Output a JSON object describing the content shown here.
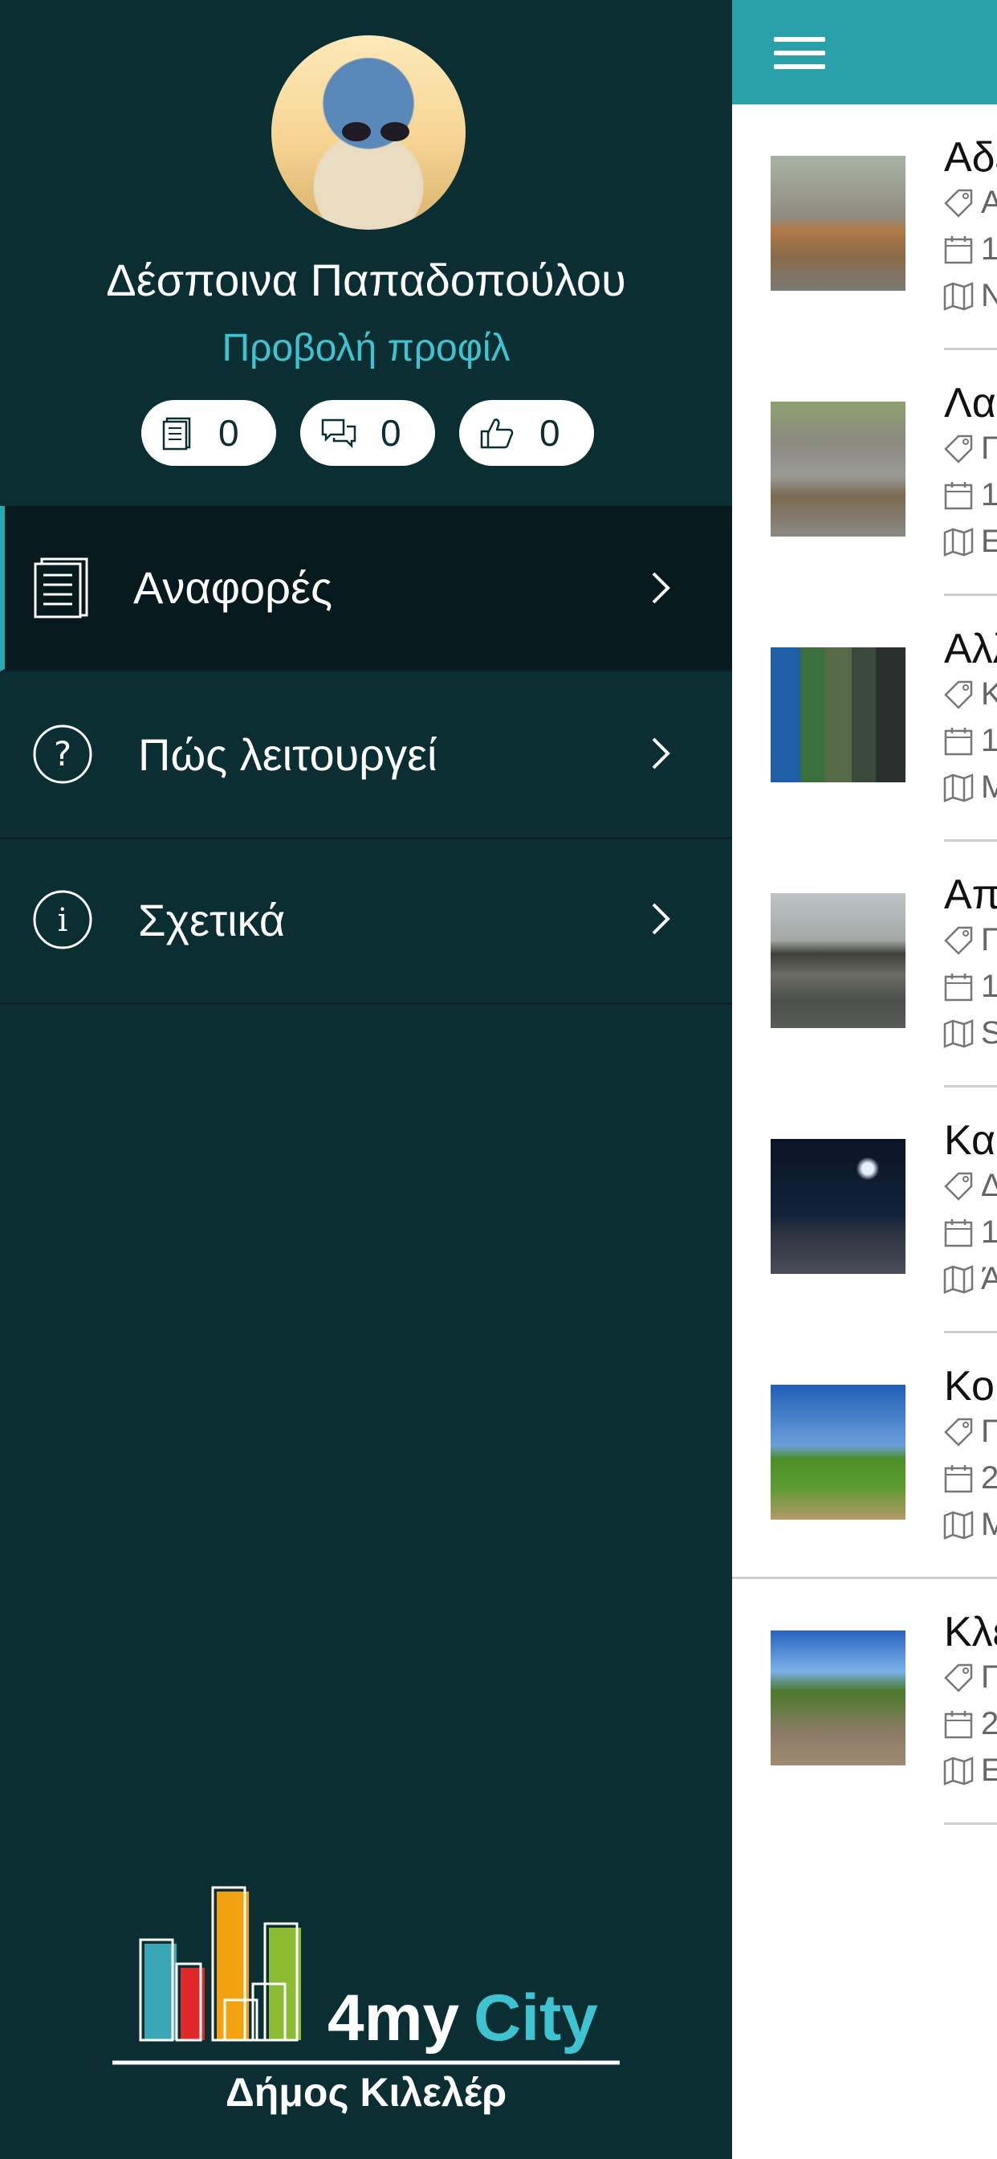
{
  "drawer": {
    "user_name": "Δέσποινα Παπαδοπούλου",
    "profile_link": "Προβολή προφίλ",
    "stats": [
      {
        "icon": "reports-icon",
        "count": "0"
      },
      {
        "icon": "comments-icon",
        "count": "0"
      },
      {
        "icon": "thumbs-up-icon",
        "count": "0"
      }
    ],
    "menu": [
      {
        "label": "Αναφορές",
        "icon": "reports-icon",
        "active": true
      },
      {
        "label": "Πώς λειτουργεί",
        "icon": "question-icon",
        "active": false
      },
      {
        "label": "Σχετικά",
        "icon": "info-icon",
        "active": false
      }
    ],
    "logo_text_1": "4my",
    "logo_text_2": "City",
    "municipality": "Δήμος Κιλελέρ"
  },
  "reports": [
    {
      "title": "Αδε",
      "tag": "Α",
      "date": "1",
      "place": "Ν"
    },
    {
      "title": "Λακ",
      "tag": "Γ",
      "date": "1",
      "place": "Ε"
    },
    {
      "title": "Αλλ",
      "tag": "Κ",
      "date": "1",
      "place": "Μ"
    },
    {
      "title": "Απ",
      "tag": "Γ",
      "date": "1",
      "place": "S"
    },
    {
      "title": "Κα",
      "tag": "Δ",
      "date": "1",
      "place": "Ά"
    },
    {
      "title": "Κο",
      "tag": "Γ",
      "date": "2",
      "place": "Μ"
    },
    {
      "title": "Κλε",
      "tag": "Γ",
      "date": "2",
      "place": "Ε"
    }
  ],
  "colors": {
    "drawer_bg": "#0b2e33",
    "accent": "#2aa1a8",
    "link": "#3ec3d0"
  }
}
